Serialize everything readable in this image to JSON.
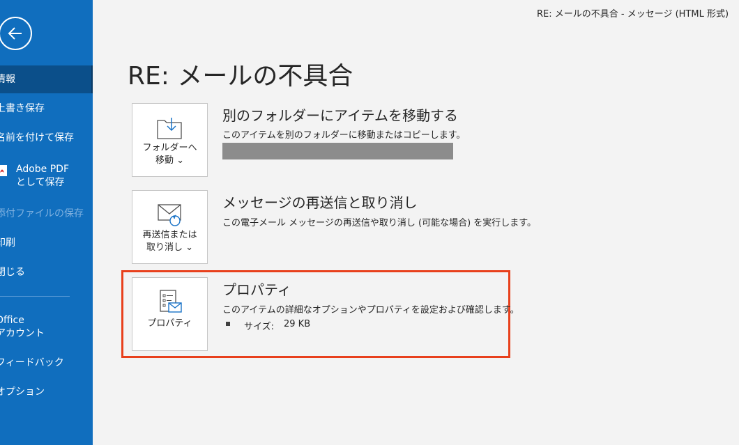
{
  "window": {
    "title": "RE: メールの不具合  -  メッセージ (HTML 形式)"
  },
  "sidebar": {
    "back_label": "戻る",
    "items": [
      {
        "label": "情報"
      },
      {
        "label": "上書き保存"
      },
      {
        "label": "名前を付けて保存"
      },
      {
        "label": "Adobe PDF"
      },
      {
        "label": "として保存"
      },
      {
        "label": "添付ファイルの保存"
      },
      {
        "label": "印刷"
      },
      {
        "label": "閉じる"
      },
      {
        "label": "Office"
      },
      {
        "label": "アカウント"
      },
      {
        "label": "フィードバック"
      },
      {
        "label": "オプション"
      }
    ]
  },
  "main": {
    "page_title": "RE: メールの不具合",
    "sections": [
      {
        "tile_line1": "フォルダーへ",
        "tile_line2": "移動 ⌄",
        "icon": "move-to-folder-icon",
        "title": "別のフォルダーにアイテムを移動する",
        "desc": "このアイテムを別のフォルダーに移動またはコピーします。"
      },
      {
        "tile_line1": "再送信または",
        "tile_line2": "取り消し ⌄",
        "icon": "resend-recall-icon",
        "title": "メッセージの再送信と取り消し",
        "desc": "この電子メール メッセージの再送信や取り消し (可能な場合) を実行します。"
      },
      {
        "tile_line1": "プロパティ",
        "icon": "properties-icon",
        "title": "プロパティ",
        "desc": "このアイテムの詳細なオプションやプロパティを設定および確認します。",
        "size_label": "サイズ:",
        "size_value": "29 KB"
      }
    ]
  },
  "colors": {
    "sidebar": "#106ebe",
    "sidebar_selected": "#0b4f8a",
    "highlight": "#e8401c",
    "background": "#f3f3f3"
  }
}
